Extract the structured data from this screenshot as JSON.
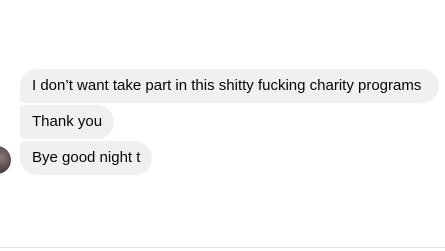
{
  "conversation": {
    "messages": [
      {
        "text": "I don’t want take part in this shitty fucking charity programs"
      },
      {
        "text": "Thank you"
      },
      {
        "text": "Bye good night t"
      }
    ]
  }
}
